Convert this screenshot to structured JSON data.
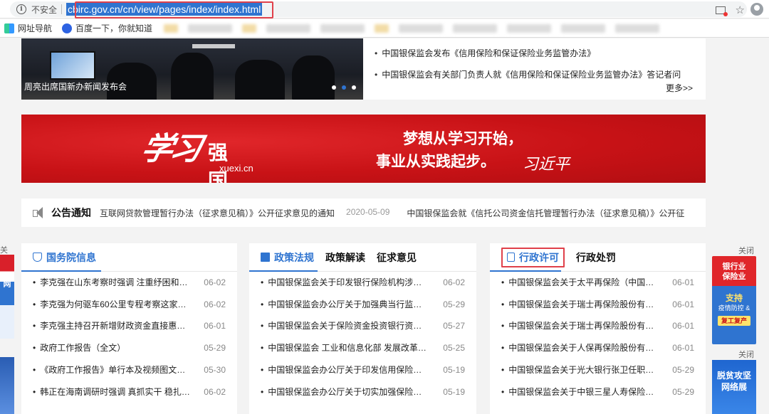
{
  "browser": {
    "security_label": "不安全",
    "url": "cbirc.gov.cn/cn/view/pages/index/index.html",
    "bookmarks": [
      {
        "label": "网址导航",
        "icon": "grid-icon"
      },
      {
        "label": "百度一下，你就知道",
        "icon": "baidu-paw-icon"
      }
    ]
  },
  "top": {
    "photo_caption": "周亮出席国新办新闻发布会",
    "news": [
      "中国银保监会发布《信用保险和保证保险业务监管办法》",
      "中国银保监会有关部门负责人就《信用保险和保证保险业务监管办法》答记者问"
    ],
    "more": "更多>>"
  },
  "banner": {
    "logo_script": "学习",
    "logo_text": "强国",
    "logo_domain": "xuexi.cn",
    "slogan_line1": "梦想从学习开始，",
    "slogan_line2": "事业从实践起步。",
    "signature": "习近平"
  },
  "notice": {
    "label": "公告通知",
    "items": [
      {
        "text": "互联网贷款管理暂行办法（征求意见稿）》公开征求意见的通知",
        "date": "2020-05-09"
      },
      {
        "text": "中国银保监会就《信托公司资金信托管理暂行办法（征求意见稿）》公开征"
      }
    ]
  },
  "cards": [
    {
      "tabs": [
        "国务院信息"
      ],
      "rows": [
        {
          "title": "李克强在山东考察时强调 注重纾困和…",
          "date": "06-02"
        },
        {
          "title": "李克强为何驱车60公里专程考察这家…",
          "date": "06-02"
        },
        {
          "title": "李克强主持召开新增财政资金直接惠…",
          "date": "06-01"
        },
        {
          "title": "政府工作报告（全文）",
          "date": "05-29"
        },
        {
          "title": "《政府工作报告》单行本及视频图文…",
          "date": "05-30"
        },
        {
          "title": "韩正在海南调研时强调 真抓实干 稳扎…",
          "date": "06-02"
        }
      ]
    },
    {
      "tabs": [
        "政策法规",
        "政策解读",
        "征求意见"
      ],
      "rows": [
        {
          "title": "中国银保监会关于印发银行保险机构涉…",
          "date": "06-02"
        },
        {
          "title": "中国银保监会办公厅关于加强典当行监…",
          "date": "05-29"
        },
        {
          "title": "中国银保监会关于保险资金投资银行资…",
          "date": "05-27"
        },
        {
          "title": "中国银保监会 工业和信息化部 发展改革…",
          "date": "05-25"
        },
        {
          "title": "中国银保监会办公厅关于印发信用保险…",
          "date": "05-19"
        },
        {
          "title": "中国银保监会办公厅关于切实加强保险…",
          "date": "05-19"
        }
      ]
    },
    {
      "tabs": [
        "行政许可",
        "行政处罚"
      ],
      "rows": [
        {
          "title": "中国银保监会关于太平再保险（中国…",
          "date": "06-01"
        },
        {
          "title": "中国银保监会关于瑞士再保险股份有…",
          "date": "06-01"
        },
        {
          "title": "中国银保监会关于瑞士再保险股份有…",
          "date": "06-01"
        },
        {
          "title": "中国银保监会关于人保再保险股份有…",
          "date": "06-01"
        },
        {
          "title": "中国银保监会关于光大银行张卫任职…",
          "date": "05-29"
        },
        {
          "title": "中国银保监会关于中银三星人寿保险…",
          "date": "05-29"
        }
      ]
    }
  ],
  "side": {
    "close": "关闭",
    "left_text": "院网",
    "ad1_line1": "银行业",
    "ad1_line2": "保险业",
    "ad1_line3": "支持",
    "ad1_line4": "疫情防控 &",
    "ad1_line5": "复工复产",
    "ad2_line1": "脱贫攻坚",
    "ad2_line2": "网络展"
  },
  "colors": {
    "accent": "#2f74d0",
    "banner_red": "#c81216",
    "highlight_red": "#e0404a"
  }
}
